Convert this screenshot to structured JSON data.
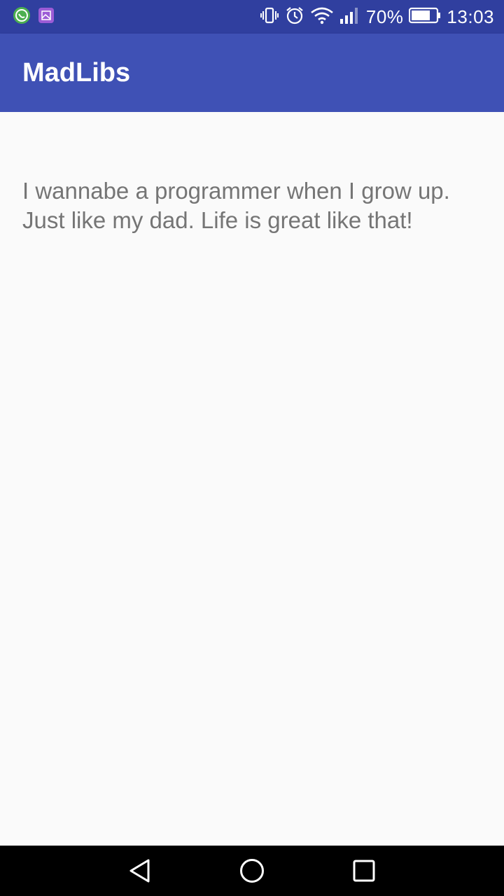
{
  "status_bar": {
    "left_icons": [
      "whatsapp-icon",
      "gallery-icon"
    ],
    "right_icons": [
      "vibrate-icon",
      "alarm-icon",
      "wifi-icon",
      "signal-icon",
      "battery-icon"
    ],
    "battery_percent": "70%",
    "time": "13:03",
    "background": "#303f9f"
  },
  "app_bar": {
    "title": "MadLibs",
    "background": "#3f51b5"
  },
  "main": {
    "story": "I wannabe a programmer when I grow up. Just like my dad. Life is great like that!"
  },
  "nav_bar": {
    "buttons": [
      "back-icon",
      "home-icon",
      "recents-icon"
    ]
  }
}
